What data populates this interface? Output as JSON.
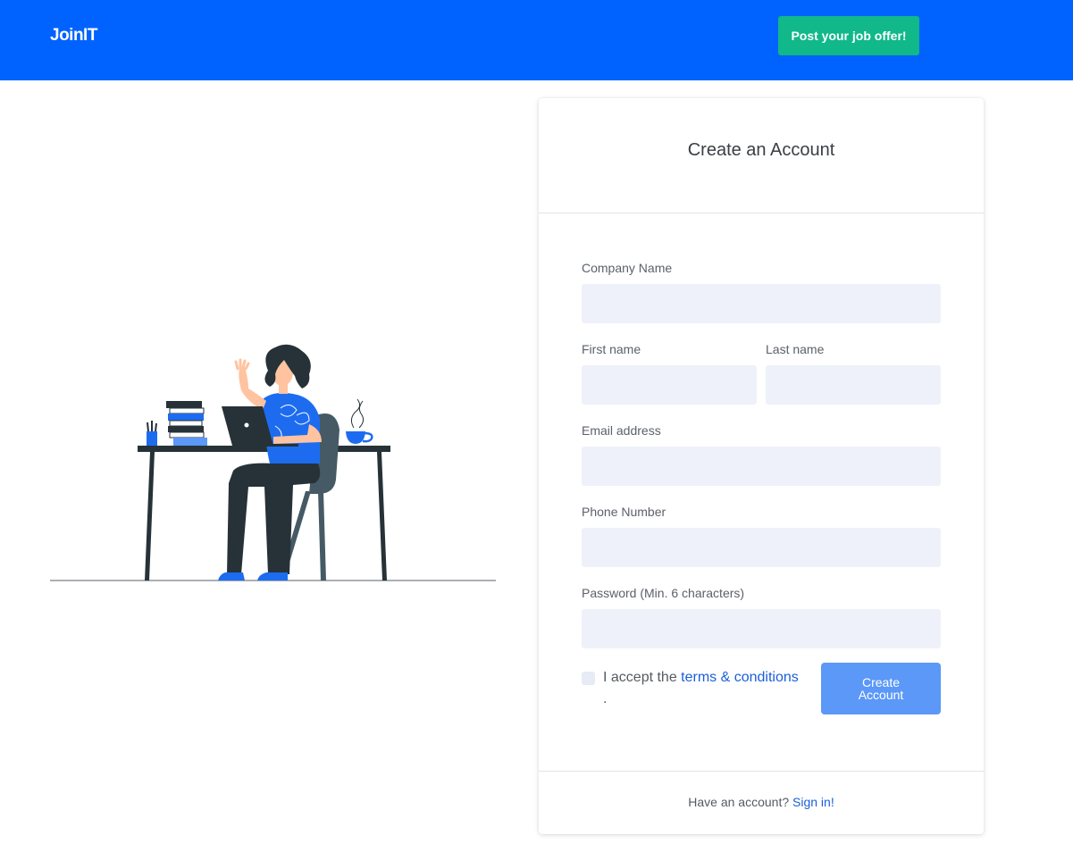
{
  "header": {
    "logo": "JoinIT",
    "post_button": "Post your job offer!"
  },
  "illustration": {
    "name": "person-at-desk-illustration"
  },
  "form": {
    "title": "Create an Account",
    "company_label": "Company Name",
    "company_value": "",
    "first_name_label": "First name",
    "first_name_value": "",
    "last_name_label": "Last name",
    "last_name_value": "",
    "email_label": "Email address",
    "email_value": "",
    "phone_label": "Phone Number",
    "phone_value": "",
    "password_label": "Password (Min. 6 characters)",
    "password_value": "",
    "accept_prefix": "I accept the",
    "terms_link": "terms & conditions",
    "accept_suffix": ".",
    "accept_checked": false,
    "submit_button": "Create Account"
  },
  "footer": {
    "prompt": "Have an account?",
    "signin_link": "Sign in!"
  },
  "colors": {
    "header_bg": "#0062ff",
    "post_button_bg": "#10b88a",
    "input_bg": "#eef1f9",
    "submit_bg": "#5b98f7",
    "link": "#1a5fd8"
  }
}
